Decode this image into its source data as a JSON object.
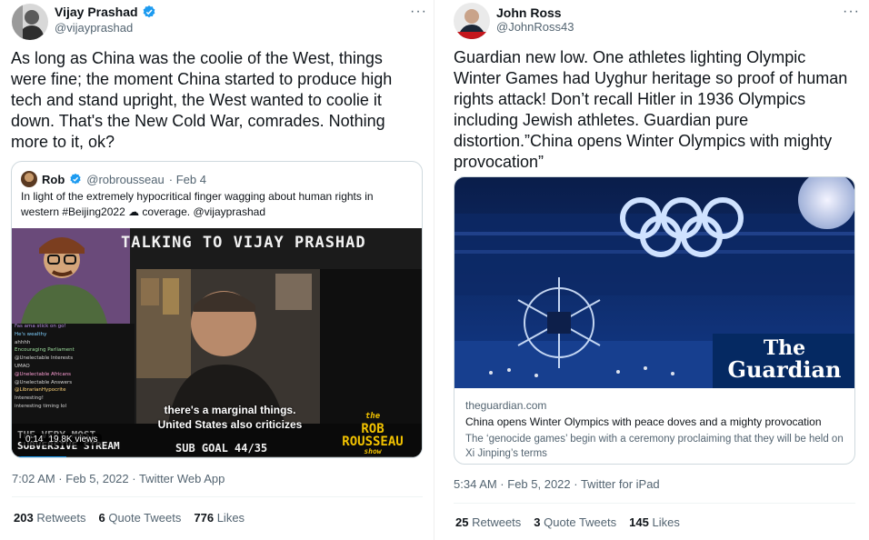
{
  "left_tweet": {
    "author_name": "Vijay Prashad",
    "author_handle": "@vijayprashad",
    "more_icon": "more-icon",
    "text": "As long as China was the coolie of the West, things were fine; the moment China started to produce high tech and stand upright, the West wanted to coolie it down. That's the New Cold War, comrades. Nothing more to it, ok?",
    "quoted": {
      "author_name": "Rob",
      "author_handle": "@robrousseau",
      "date": "· Feb 4",
      "text": "In light of the extremely hypocritical finger wagging about human rights in western #Beijing2022 ☁ coverage. @vijayprashad",
      "video": {
        "banner": "TALKING TO VIJAY PRASHAD",
        "caption_line1": "there's a marginal things.",
        "caption_line2": "United States also criticizes",
        "chat_lines": [
          "Fas ama stick on go!",
          "He's wealthy",
          "ahhhh",
          "",
          "Encouraging Parliament",
          "@Unelectable Interests",
          "UMAO",
          "@Unelectable Africans",
          "@Unelectable Answers",
          "@LibrarianHypocrite",
          "Interesting!",
          "interesting timing lol"
        ],
        "bottom_left": "THE VERY MOST",
        "bottom_left2": "SUBVERSIVE STREAM",
        "sub_goal": "SUB GOAL 44/35",
        "show_logo_1": "the",
        "show_logo_2": "ROB",
        "show_logo_3": "ROUSSEAU",
        "show_logo_4": "show",
        "timestamp": "0:14",
        "views": "19.8K views"
      }
    },
    "meta": "7:02 AM · Feb 5, 2022 · Twitter Web App",
    "retweets_count": "203",
    "retweets_label": "Retweets",
    "quotes_count": "6",
    "quotes_label": "Quote Tweets",
    "likes_count": "776",
    "likes_label": "Likes"
  },
  "right_tweet": {
    "author_name": "John Ross",
    "author_handle": "@JohnRoss43",
    "text": "Guardian new low. One athletes lighting Olympic Winter Games had Uyghur heritage so proof of human rights attack! Don’t recall Hitler in 1936 Olympics including Jewish athletes. Guardian pure distortion.”China opens Winter Olympics with mighty provocation”",
    "link_card": {
      "logo_line1": "The",
      "logo_line2": "Guardian",
      "domain": "theguardian.com",
      "title": "China opens Winter Olympics with peace doves and a mighty provocation",
      "description": "The ‘genocide games’ begin with a ceremony proclaiming that they will be held on Xi Jinping’s terms"
    },
    "meta": "5:34 AM · Feb 5, 2022 · Twitter for iPad",
    "retweets_count": "25",
    "retweets_label": "Retweets",
    "quotes_count": "3",
    "quotes_label": "Quote Tweets",
    "likes_count": "145",
    "likes_label": "Likes"
  },
  "colors": {
    "verified_blue": "#1d9bf0",
    "text_primary": "#0f1419",
    "text_secondary": "#536471",
    "border": "#cfd9de",
    "guardian_blue": "#052962"
  }
}
